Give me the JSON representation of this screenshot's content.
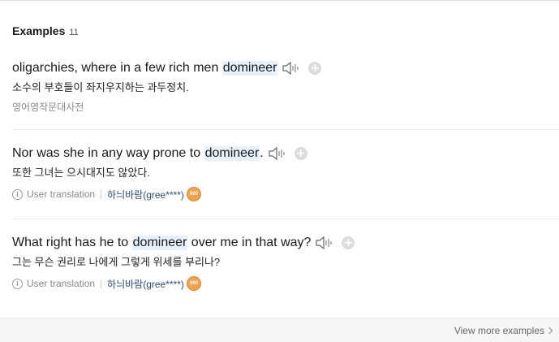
{
  "section": {
    "title": "Examples",
    "count": "11"
  },
  "examples": [
    {
      "en_before": "oligarchies, where in a few rich men ",
      "en_highlight": "domineer",
      "en_after": "",
      "ko": "소수의 부호들이 좌지우지하는 과두정치.",
      "source": "영어영작문대사전"
    },
    {
      "en_before": "Nor was she in any way prone to ",
      "en_highlight": "domineer",
      "en_after": ".",
      "ko": "또한 그녀는 으시대지도 않았다.",
      "meta_label": "User translation",
      "user": "하늬바람(gree****)",
      "badge": "800"
    },
    {
      "en_before": "What right has he to ",
      "en_highlight": "domineer",
      "en_after": " over me in that way?",
      "ko": "그는 무슨 권리로 나에게 그렇게 위세를 부리나?",
      "meta_label": "User translation",
      "user": "하늬바람(gree****)",
      "badge": "800"
    }
  ],
  "footer": {
    "more_label": "View more examples"
  },
  "icons": {
    "speaker": "speaker-icon",
    "plus": "add-icon",
    "info": "info-icon",
    "chevron": "chevron-right-icon"
  },
  "colors": {
    "highlight": "#e6f1fb",
    "badge": "#f3a24b",
    "user_link": "#2e4e7c"
  }
}
